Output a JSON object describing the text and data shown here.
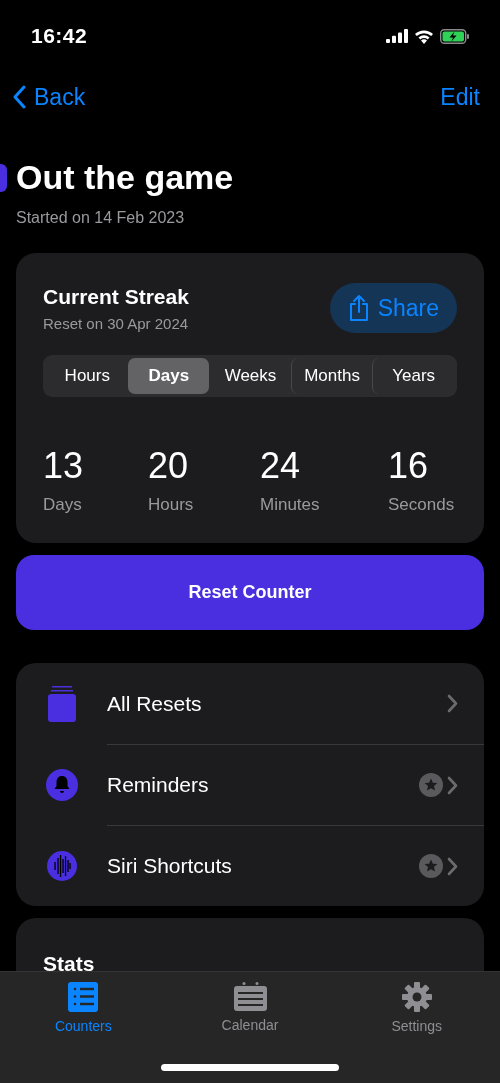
{
  "status_bar": {
    "time": "16:42"
  },
  "nav": {
    "back": "Back",
    "action": "Edit"
  },
  "title": "Out the game",
  "subtitle": "Started on 14 Feb 2023",
  "streak": {
    "title": "Current Streak",
    "subtitle": "Reset on 30 Apr 2024",
    "share": "Share",
    "segments": [
      {
        "label": "Hours",
        "selected": false
      },
      {
        "label": "Days",
        "selected": true
      },
      {
        "label": "Weeks",
        "selected": false
      },
      {
        "label": "Months",
        "selected": false
      },
      {
        "label": "Years",
        "selected": false
      }
    ],
    "counts": [
      {
        "value": "13",
        "unit": "Days"
      },
      {
        "value": "20",
        "unit": "Hours"
      },
      {
        "value": "24",
        "unit": "Minutes"
      },
      {
        "value": "16",
        "unit": "Seconds"
      }
    ]
  },
  "reset_button": "Reset Counter",
  "menu": [
    {
      "label": "All Resets",
      "premium": false
    },
    {
      "label": "Reminders",
      "premium": true
    },
    {
      "label": "Siri Shortcuts",
      "premium": true
    }
  ],
  "stats": {
    "title": "Stats"
  },
  "tab_bar": [
    {
      "label": "Counters",
      "selected": true
    },
    {
      "label": "Calendar",
      "selected": false
    },
    {
      "label": "Settings",
      "selected": false
    }
  ]
}
